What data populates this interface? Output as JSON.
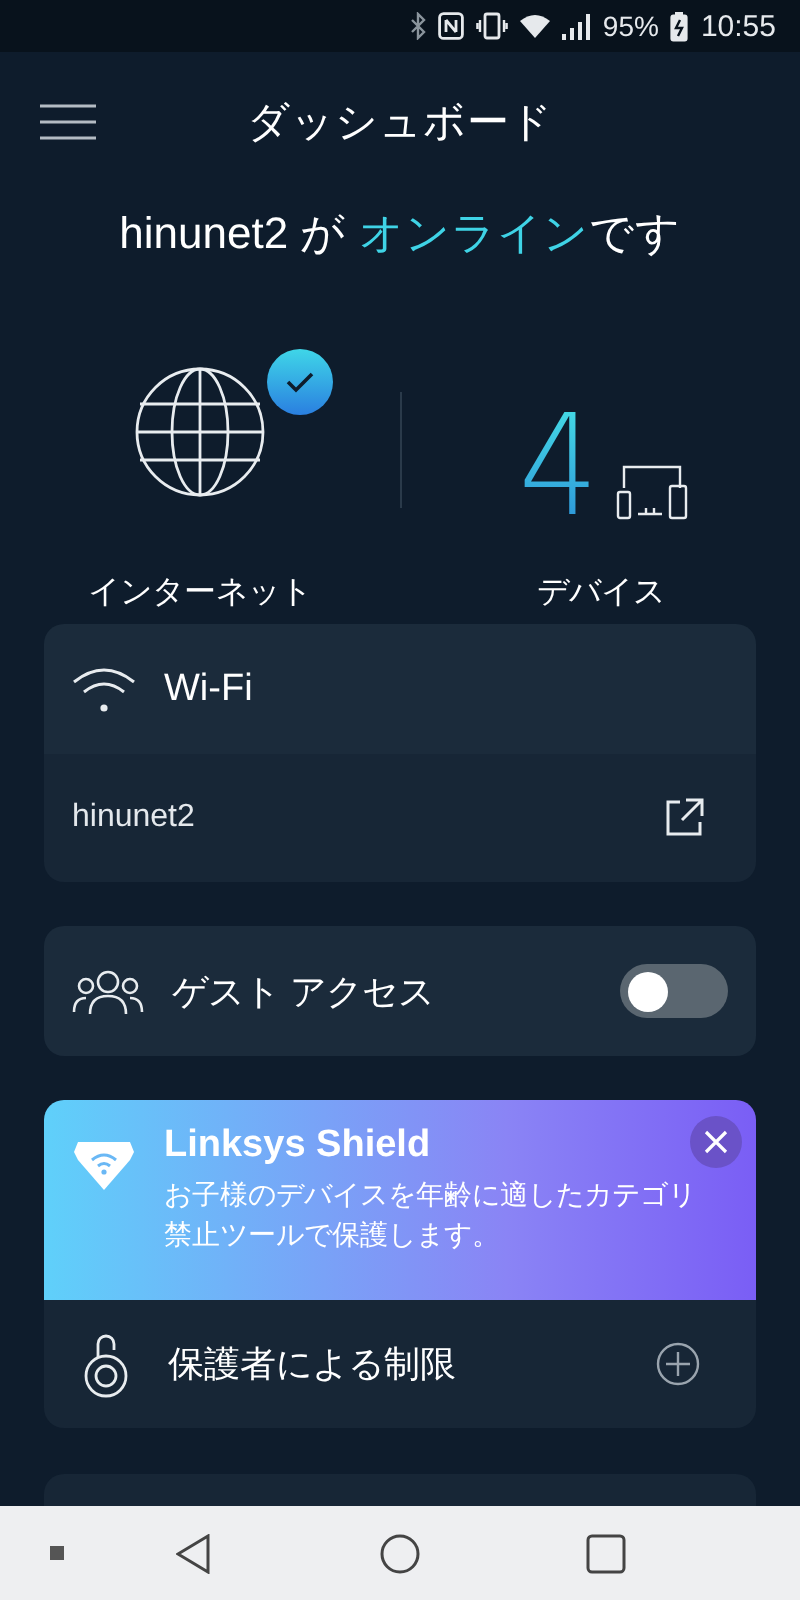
{
  "status_bar": {
    "battery": "95%",
    "time": "10:55"
  },
  "header": {
    "title": "ダッシュボード"
  },
  "headline": {
    "prefix": "hinunet2 が ",
    "highlight": "オンライン",
    "suffix": "です"
  },
  "stats": {
    "internet": {
      "label": "インターネット",
      "connected": true
    },
    "devices": {
      "count": "4",
      "label": "デバイス"
    }
  },
  "wifi_card": {
    "title": "Wi-Fi",
    "network": "hinunet2"
  },
  "guest_access": {
    "label": "ゲスト アクセス",
    "on": false
  },
  "shield": {
    "title": "Linksys Shield",
    "description": "お子様のデバイスを年齢に適したカテゴリ禁止ツールで保護します。",
    "row_label": "保護者による制限"
  }
}
